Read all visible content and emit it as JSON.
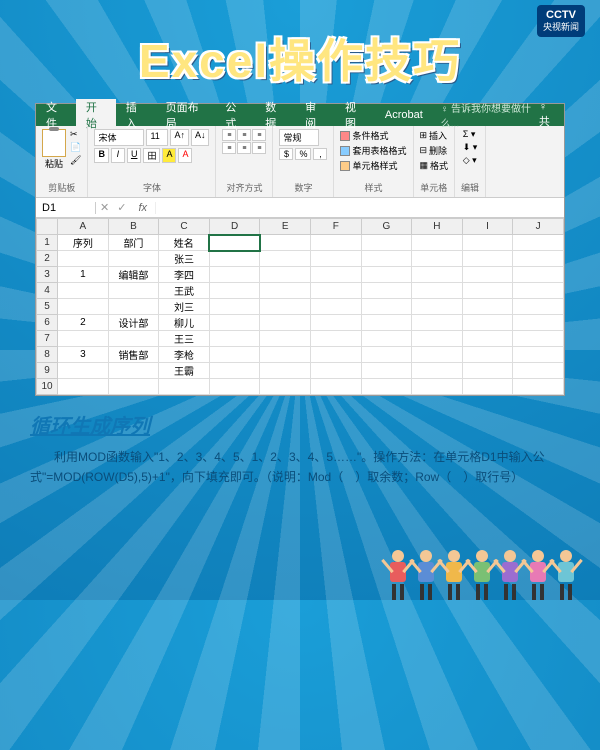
{
  "logo": {
    "main": "CCTV",
    "sub": "央视新闻"
  },
  "title": "Excel操作技巧",
  "tabs": {
    "items": [
      "文件",
      "开始",
      "插入",
      "页面布局",
      "公式",
      "数据",
      "审阅",
      "视图",
      "Acrobat"
    ],
    "tell": "♀ 告诉我你想要做什么...",
    "share": "♀ 共"
  },
  "ribbon": {
    "clipboard": {
      "paste": "粘贴",
      "label": "剪贴板"
    },
    "font": {
      "name": "宋体",
      "size": "11",
      "label": "字体"
    },
    "align": {
      "label": "对齐方式"
    },
    "number": {
      "format": "常规",
      "label": "数字"
    },
    "styles": {
      "cond": "条件格式",
      "table": "套用表格格式",
      "cell": "单元格样式",
      "label": "样式"
    },
    "cells": {
      "insert": "插入",
      "delete": "删除",
      "format": "格式",
      "label": "单元格"
    },
    "edit": {
      "label": "编辑"
    }
  },
  "namebox": "D1",
  "formula": "",
  "columns": [
    "A",
    "B",
    "C",
    "D",
    "E",
    "F",
    "G",
    "H",
    "I",
    "J"
  ],
  "rows": [
    {
      "n": "1",
      "A": "序列",
      "B": "部门",
      "C": "姓名"
    },
    {
      "n": "2",
      "A": "",
      "B": "",
      "C": "张三"
    },
    {
      "n": "3",
      "A": "1",
      "B": "编辑部",
      "C": "李四"
    },
    {
      "n": "4",
      "A": "",
      "B": "",
      "C": "王武"
    },
    {
      "n": "5",
      "A": "",
      "B": "",
      "C": "刘三"
    },
    {
      "n": "6",
      "A": "2",
      "B": "设计部",
      "C": "柳儿"
    },
    {
      "n": "7",
      "A": "",
      "B": "",
      "C": "王三"
    },
    {
      "n": "8",
      "A": "3",
      "B": "销售部",
      "C": "李枪"
    },
    {
      "n": "9",
      "A": "",
      "B": "",
      "C": "王霸"
    },
    {
      "n": "10",
      "A": "",
      "B": "",
      "C": ""
    }
  ],
  "subtitle": "循环生成序列",
  "desc": "利用MOD函数输入\"1、2、3、4、5、1、2、3、4、5……\"。操作方法：在单元格D1中输入公式\"=MOD(ROW(D5),5)+1\"，向下填充即可。（说明：Mod（　）取余数；Row（　）取行号）",
  "people_colors": [
    "#e85d5d",
    "#5b8dd6",
    "#f0b84a",
    "#7ac074",
    "#9b6dd0",
    "#e87ab5",
    "#6dc5d6"
  ]
}
